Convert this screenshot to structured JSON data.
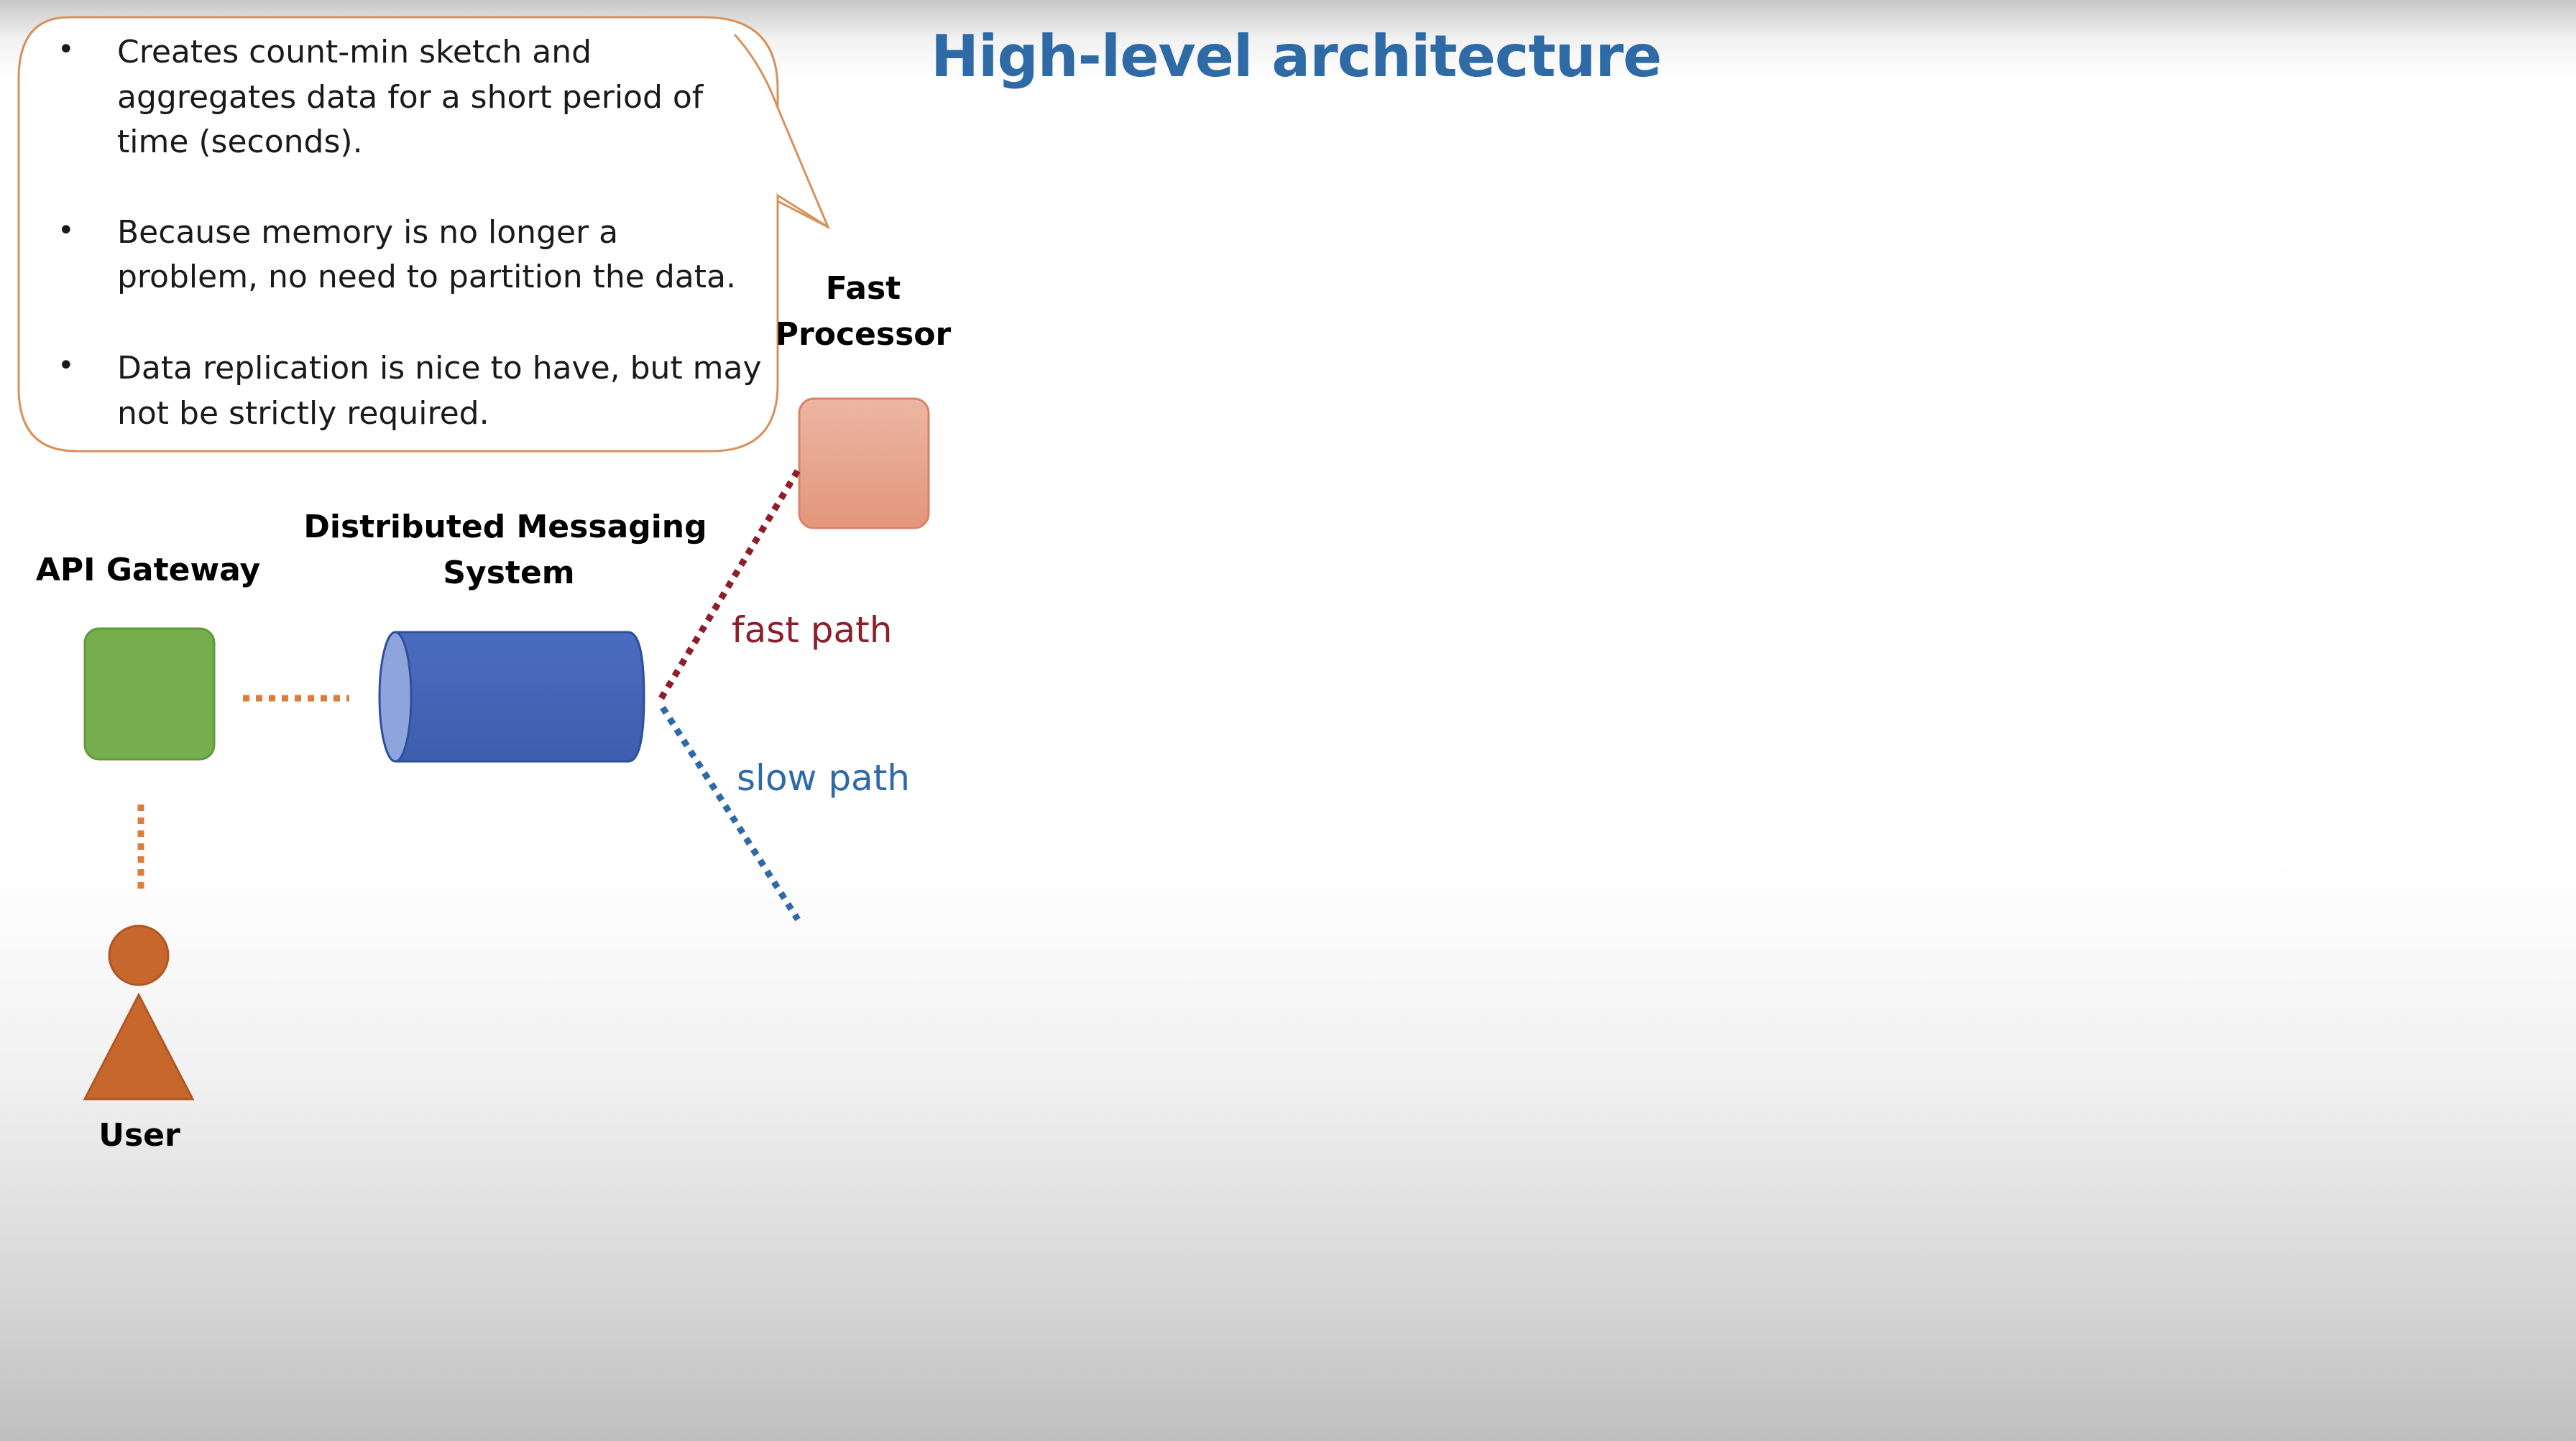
{
  "title": "High-level architecture",
  "callout": {
    "bullet_symbol": "•",
    "bullets": [
      [
        "Creates count-min sketch and",
        "aggregates data for a short period of",
        "time (seconds)."
      ],
      [
        "Because memory is no longer a",
        "problem, no need to partition the data."
      ],
      [
        "Data replication is nice to have, but may",
        "not be strictly required."
      ]
    ],
    "border_color": "#d9915a"
  },
  "nodes": {
    "fast_processor": {
      "label_lines": [
        "Fast",
        "Processor"
      ],
      "color": "#e8a48c"
    },
    "messaging": {
      "label_lines": [
        "Distributed Messaging",
        "System"
      ],
      "color": "#4666b8"
    },
    "api_gateway": {
      "label": "API Gateway",
      "color": "#76ae4d"
    },
    "user": {
      "label": "User",
      "color": "#c8672c"
    }
  },
  "edges": {
    "fast_path": {
      "label": "fast path",
      "color": "#8c1f2a"
    },
    "slow_path": {
      "label": "slow path",
      "color": "#2f6aa8"
    },
    "connector_color": "#dd7d39"
  }
}
